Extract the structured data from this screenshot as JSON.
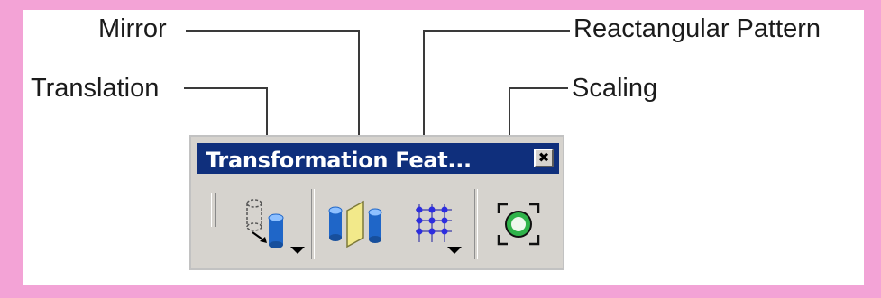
{
  "callouts": {
    "mirror": "Mirror",
    "rectangular_pattern": "Reactangular Pattern",
    "translation": "Translation",
    "scaling": "Scaling"
  },
  "toolbar": {
    "title": "Transformation Feat...",
    "close_glyph": "✖",
    "buttons": [
      {
        "name": "translation",
        "icon": "translation-icon",
        "has_dropdown": true
      },
      {
        "name": "mirror",
        "icon": "mirror-icon",
        "has_dropdown": false
      },
      {
        "name": "rectangular-pattern",
        "icon": "rectangular-pattern-icon",
        "has_dropdown": true
      },
      {
        "name": "scaling",
        "icon": "scaling-icon",
        "has_dropdown": false
      }
    ]
  },
  "colors": {
    "frame": "#f3a3d6",
    "titlebar": "#0f2f7c",
    "toolbar_face": "#d6d3ce",
    "leader_line": "#3a3a3a"
  }
}
